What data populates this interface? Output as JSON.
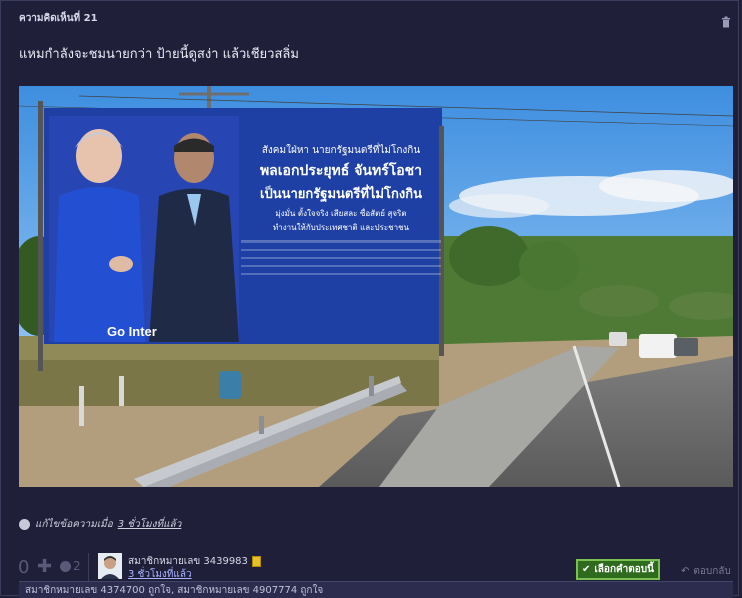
{
  "comment": {
    "header_label": "ความคิดเห็นที่ 21",
    "title": "แหมกำลังจะชมนายกว่า ป้ายนี้ดูสง่า แล้วเชียวสลิ่ม",
    "image": {
      "billboard_lines": [
        "สังคมใฝ่หา นายกรัฐมนตรีที่ไม่โกงกิน",
        "พลเอกประยุทธ์ จันทร์โอชา",
        "เป็นนายกรัฐมนตรีที่ไม่โกงกิน",
        "มุ่งมั่น ตั้งใจจริง เสียสละ ซื่อสัตย์ สุจริต",
        "ทำงานให้กับประเทศชาติ และประชาชน"
      ],
      "billboard_brand": "Go Inter"
    },
    "edit_note": {
      "prefix": "แก้ไขข้อความเมื่อ",
      "time": "3 ชั่วโมงที่แล้ว"
    }
  },
  "footer": {
    "vote_count": "0",
    "plus_symbol": "✚",
    "emotion_count": "2",
    "member_name": "สมาชิกหมายเลข 3439983",
    "posted_time": "3 ชั่วโมงที่แล้ว",
    "choose_answer_label": "เลือกคำตอบนี้",
    "reply_label": "ตอบกลับ"
  },
  "likes_bar": {
    "text": "สมาชิกหมายเลข 4374700 ถูกใจ, สมาชิกหมายเลข 4907774 ถูกใจ"
  },
  "colors": {
    "background": "#1f1f3a",
    "accent_green": "#2f6b1f",
    "link": "#a8b4ff"
  },
  "icons": [
    "trash-icon",
    "edit-icon",
    "plus-icon",
    "emotion-icon",
    "member-badge-icon",
    "check-icon",
    "reply-icon"
  ]
}
